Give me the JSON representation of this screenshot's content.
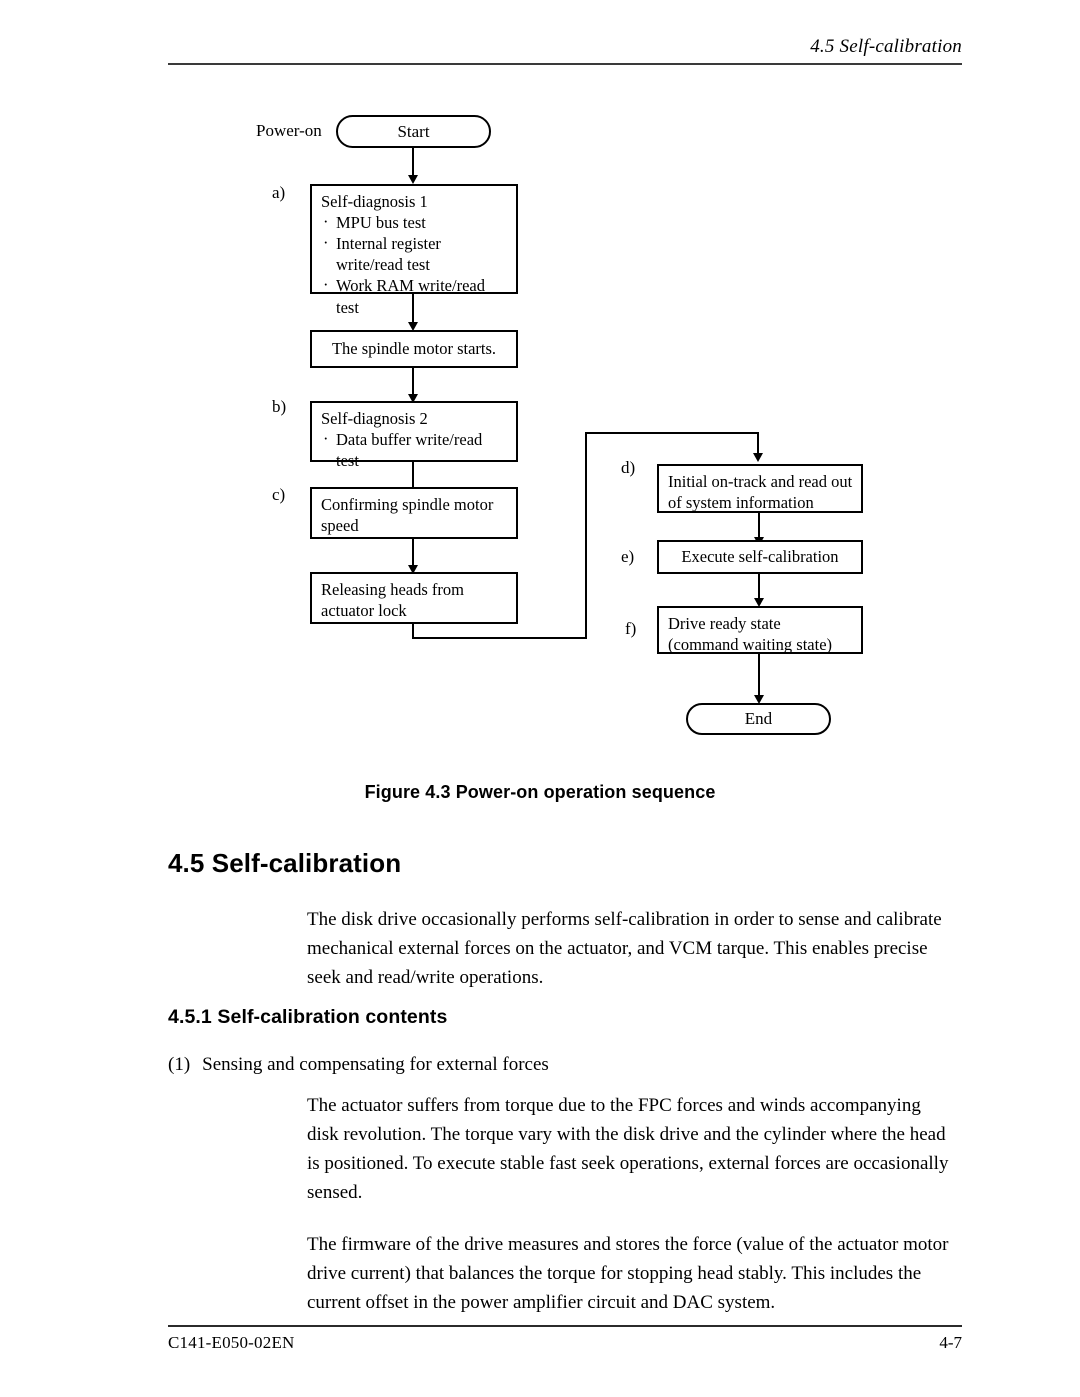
{
  "header": {
    "running_head": "4.5  Self-calibration"
  },
  "footer": {
    "doc_number": "C141-E050-02EN",
    "page_number": "4-7"
  },
  "figure": {
    "caption": "Figure 4.3 Power-on operation sequence",
    "power_on_label": "Power-on",
    "start_label": "Start",
    "end_label": "End",
    "step_labels": {
      "a": "a)",
      "b": "b)",
      "c": "c)",
      "d": "d)",
      "e": "e)",
      "f": "f)"
    },
    "boxes": {
      "self_diagnosis_1": {
        "title": "Self-diagnosis 1",
        "items": [
          "MPU bus test",
          "Internal register write/read test",
          "Work RAM write/read test"
        ]
      },
      "spindle_start": "The spindle motor starts.",
      "self_diagnosis_2": {
        "title": "Self-diagnosis 2",
        "items": [
          "Data buffer write/read test"
        ]
      },
      "confirm_spindle": "Confirming spindle motor speed",
      "release_heads": "Releasing heads from actuator lock",
      "initial_ontrack": "Initial on-track and read out of system information",
      "execute_selfcal": "Execute self-calibration",
      "drive_ready": "Drive ready state (command waiting state)"
    }
  },
  "content": {
    "section_heading": "4.5  Self-calibration",
    "intro_paragraph": "The disk drive occasionally performs self-calibration in order to sense and calibrate mechanical external forces on the actuator, and VCM tarque.  This enables precise seek and read/write operations.",
    "subsection_heading": "4.5.1  Self-calibration contents",
    "list_item_number": "(1)",
    "list_item_text": "Sensing and compensating for external forces",
    "paragraph_2": "The actuator suffers from torque due to the FPC forces and winds accompanying disk revolution.  The torque vary with the disk drive and the cylinder where the head is positioned.  To execute stable fast seek operations, external forces are occasionally sensed.",
    "paragraph_3": "The firmware of the drive measures and stores the force (value of the actuator motor drive current) that balances the torque for stopping head stably.  This includes the current offset in the power amplifier circuit and DAC system."
  }
}
